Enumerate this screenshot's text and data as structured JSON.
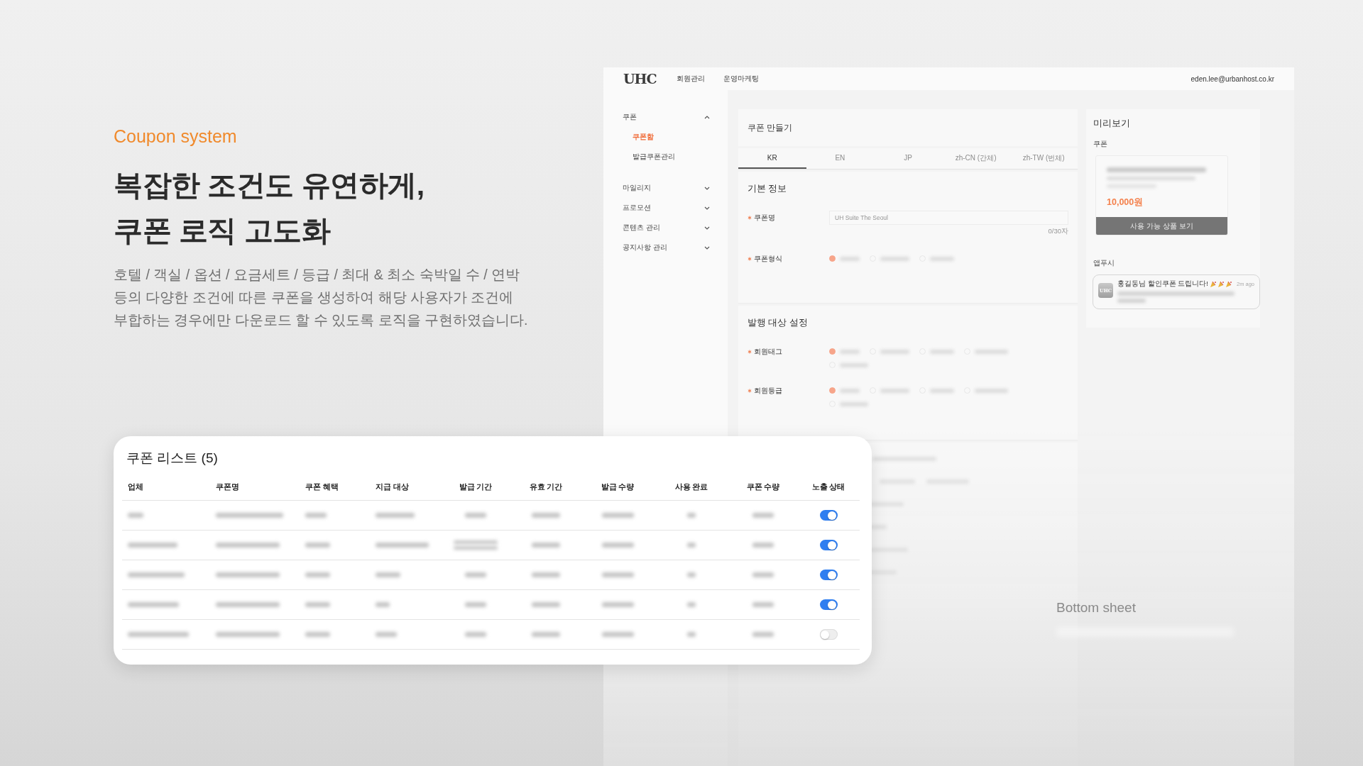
{
  "intro": {
    "eyebrow": "Coupon system",
    "heading_lines": [
      "복잡한 조건도 유연하게,",
      "쿠폰 로직 고도화"
    ],
    "body_lines": [
      "호텔 / 객실 / 옵션 / 요금세트 / 등급 / 최대 & 최소 숙박일 수 / 연박",
      "등의 다양한 조건에 따른 쿠폰을 생성하여 해당 사용자가 조건에",
      "부합하는 경우에만 다운로드 할 수 있도록 로직을 구현하였습니다."
    ]
  },
  "admin": {
    "logo": "UHC",
    "nav": [
      "회원관리",
      "운영마케팅"
    ],
    "user_email": "eden.lee@urbanhost.co.kr",
    "sidebar": [
      {
        "label": "쿠폰",
        "expanded": true,
        "children": [
          {
            "label": "쿠폰함",
            "selected": true
          },
          {
            "label": "발급쿠폰관리",
            "selected": false
          }
        ]
      },
      {
        "label": "마일리지",
        "expanded": false
      },
      {
        "label": "프로모션",
        "expanded": false
      },
      {
        "label": "콘텐츠 관리",
        "expanded": false
      },
      {
        "label": "공지사항 관리",
        "expanded": false
      }
    ],
    "form": {
      "title": "쿠폰 만들기",
      "tabs": [
        {
          "label": "KR",
          "selected": true
        },
        {
          "label": "EN",
          "selected": false
        },
        {
          "label": "JP",
          "selected": false
        },
        {
          "label": "zh-CN (간체)",
          "selected": false
        },
        {
          "label": "zh-TW (번체)",
          "selected": false
        }
      ],
      "sections": [
        {
          "title": "기본 정보",
          "fields": [
            {
              "kind": "text",
              "label": "쿠폰명",
              "required": true,
              "placeholder": "UH Suite The Seoul",
              "counter": "0/30자"
            },
            {
              "kind": "radio",
              "label": "쿠폰형식",
              "required": true,
              "options": [
                {
                  "selected": true
                },
                {
                  "selected": false
                },
                {
                  "selected": false
                }
              ]
            }
          ]
        },
        {
          "title": "발행 대상 설정",
          "fields": [
            {
              "kind": "radio",
              "label": "회원태그",
              "required": true,
              "options": [
                {
                  "selected": true
                },
                {
                  "selected": false
                },
                {
                  "selected": false
                },
                {
                  "selected": false
                },
                {
                  "selected": false
                }
              ]
            },
            {
              "kind": "radio",
              "label": "회원등급",
              "required": true,
              "options": [
                {
                  "selected": true
                },
                {
                  "selected": false
                },
                {
                  "selected": false
                },
                {
                  "selected": false
                },
                {
                  "selected": false
                }
              ]
            }
          ]
        }
      ]
    },
    "preview": {
      "title": "미리보기",
      "coupon_label": "쿠폰",
      "coupon_amount": "10,000원",
      "coupon_button": "사용 가능 상품 보기",
      "push_label": "앱푸시",
      "push_app": "UHC",
      "push_title": "홍길동님 할인쿠폰 드립니다!",
      "push_time": "2m ago"
    }
  },
  "overlay_note": "Bottom sheet",
  "coupon_list": {
    "title": "쿠폰 리스트 (5)",
    "columns": [
      "업체",
      "쿠폰명",
      "쿠폰 혜택",
      "지급 대상",
      "발급 기간",
      "유효 기간",
      "발급 수량",
      "사용 완료",
      "쿠폰 수량",
      "노출 상태"
    ],
    "rows": [
      {
        "exposed": true
      },
      {
        "exposed": true
      },
      {
        "exposed": true
      },
      {
        "exposed": true
      },
      {
        "exposed": false
      }
    ]
  }
}
